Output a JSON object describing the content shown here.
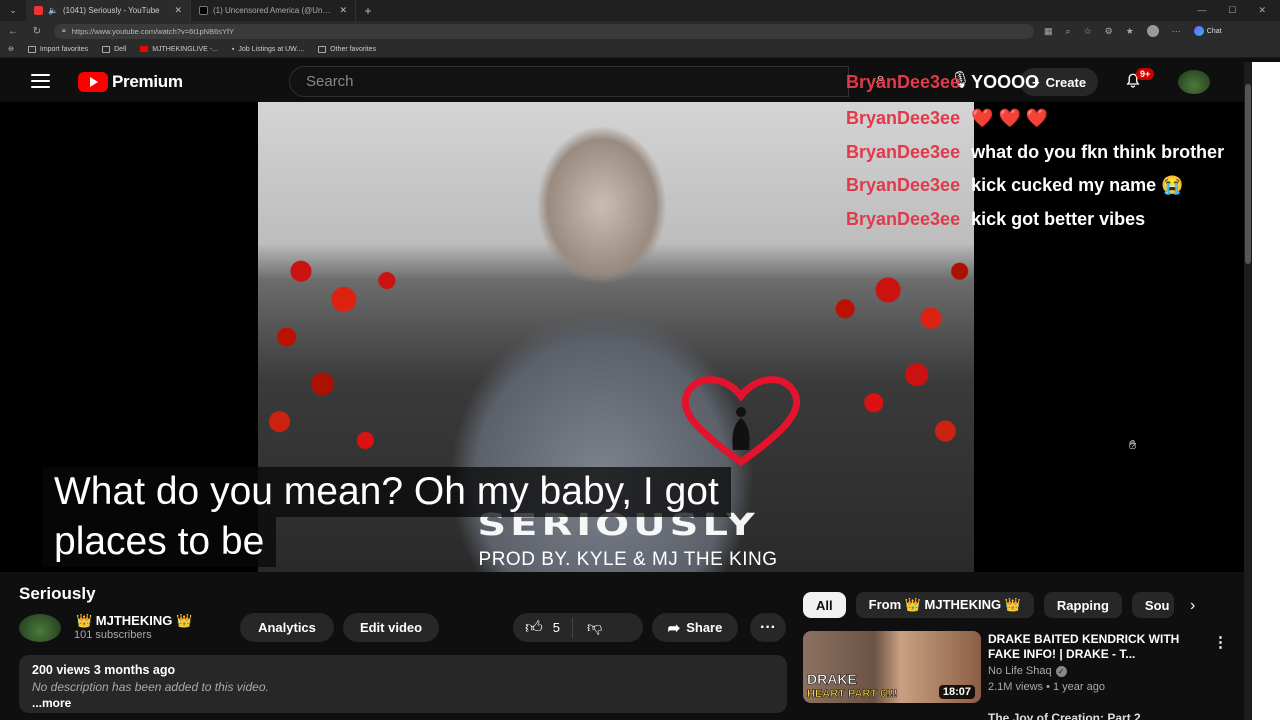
{
  "browser": {
    "tabs": [
      {
        "title": "(1041) Seriously - YouTube",
        "active": true
      },
      {
        "title": "(1) Uncensored America (@Uncen",
        "active": false
      }
    ],
    "url": "https://www.youtube.com/watch?v=6t1pNB6sYfY",
    "chat_label": "Chat",
    "bookmarks": [
      "Import favorites",
      "Dell",
      "MJTHEKINGLIVE -...",
      "Job Listings at UW...."
    ],
    "other_favorites": "Other favorites"
  },
  "youtube": {
    "logo_text": "Premium",
    "search_placeholder": "Search",
    "create_label": "Create",
    "notification_count": "9+"
  },
  "chat": [
    {
      "user": "BryanDee3ee",
      "message": "YOOOO"
    },
    {
      "user": "BryanDee3ee",
      "message": "❤️ ❤️ ❤️"
    },
    {
      "user": "BryanDee3ee",
      "message": "what do you fkn think brother"
    },
    {
      "user": "BryanDee3ee",
      "message": "kick cucked my name 😭"
    },
    {
      "user": "BryanDee3ee",
      "message": "kick got better vibes"
    }
  ],
  "captions": [
    "What do you mean? Oh my baby, I got",
    "places to be"
  ],
  "artwork": {
    "stamp": "SERIOUSLY",
    "prod": "PROD BY. KYLE & MJ THE KING"
  },
  "video": {
    "title": "Seriously",
    "channel": "👑 MJTHEKING 👑",
    "subscribers": "101 subscribers",
    "analytics_label": "Analytics",
    "edit_label": "Edit video",
    "likes": "5",
    "share_label": "Share",
    "stats": "200 views  3 months ago",
    "description": "No description has been added to this video.",
    "more_label": "...more"
  },
  "chips": [
    "All",
    "From 👑 MJTHEKING 👑",
    "Rapping",
    "Sou"
  ],
  "recommended": [
    {
      "title": "DRAKE BAITED KENDRICK WITH FAKE INFO! | DRAKE - T...",
      "channel": "No Life Shaq",
      "meta": "2.1M views • 1 year ago",
      "duration": "18:07",
      "thumb_text_1": "DRAKE",
      "thumb_text_2": "HEART PART 6!!!"
    },
    {
      "title": "The Joy of Creation: Part 2"
    }
  ]
}
